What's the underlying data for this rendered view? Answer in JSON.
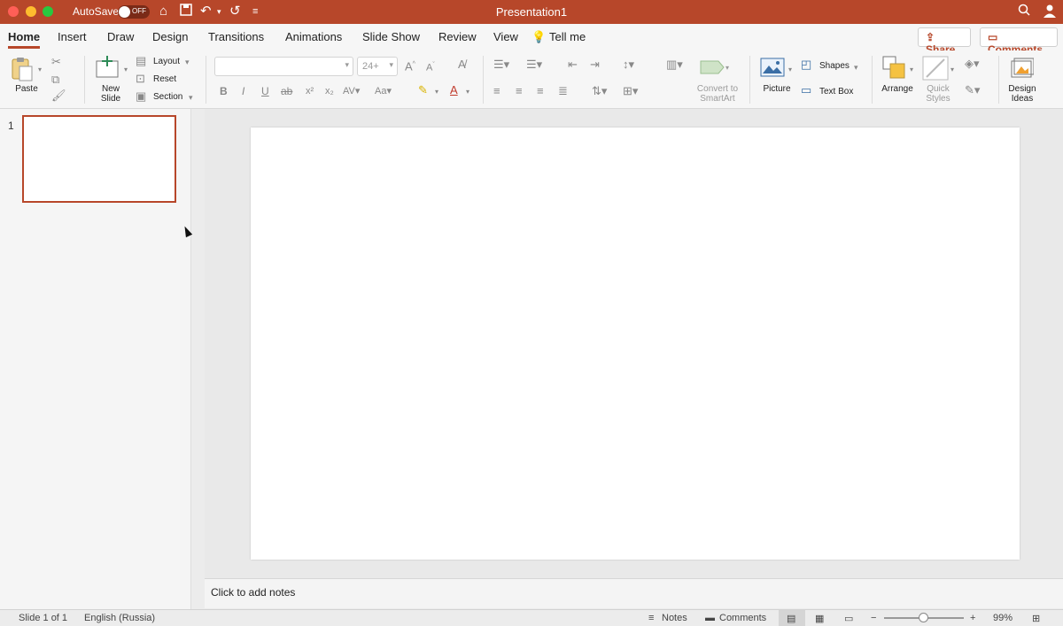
{
  "titlebar": {
    "autosave_label": "AutoSave",
    "autosave_state": "OFF",
    "title": "Presentation1"
  },
  "tabs": [
    {
      "label": "Home"
    },
    {
      "label": "Insert"
    },
    {
      "label": "Draw"
    },
    {
      "label": "Design"
    },
    {
      "label": "Transitions"
    },
    {
      "label": "Animations"
    },
    {
      "label": "Slide Show"
    },
    {
      "label": "Review"
    },
    {
      "label": "View"
    },
    {
      "label": "Tell me"
    }
  ],
  "actions": {
    "share": "Share",
    "comments": "Comments"
  },
  "ribbon": {
    "paste": "Paste",
    "new_slide_line1": "New",
    "new_slide_line2": "Slide",
    "layout": "Layout",
    "reset": "Reset",
    "section": "Section",
    "font_size": "24+",
    "convert_line1": "Convert to",
    "convert_line2": "SmartArt",
    "picture": "Picture",
    "shapes": "Shapes",
    "text_box": "Text Box",
    "arrange": "Arrange",
    "quick_styles_line1": "Quick",
    "quick_styles_line2": "Styles",
    "design_ideas_line1": "Design",
    "design_ideas_line2": "Ideas"
  },
  "slides": [
    {
      "number": "1"
    }
  ],
  "notes_placeholder": "Click to add notes",
  "statusbar": {
    "slide_info": "Slide 1 of 1",
    "language": "English (Russia)",
    "notes": "Notes",
    "comments": "Comments",
    "zoom": "99%"
  },
  "colors": {
    "accent": "#b7472a"
  }
}
